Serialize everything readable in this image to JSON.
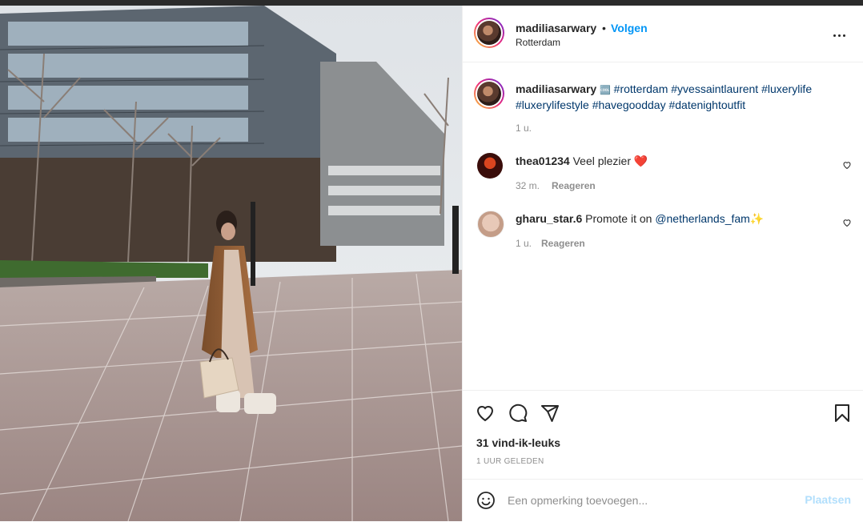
{
  "post": {
    "username": "madiliasarwary",
    "follow_label": "Volgen",
    "location": "Rotterdam",
    "more_icon": "more-options-icon",
    "caption_prefix": "🆒",
    "caption_tags_line1": "#rotterdam #yvessaintlaurent #luxerylife",
    "caption_tags_line2": "#luxerylifestyle #havegoodday #datenightoutfit",
    "caption_time": "1 u."
  },
  "comments": [
    {
      "username": "thea01234",
      "text": "Veel plezier",
      "emoji": "❤️",
      "time": "32 m.",
      "reply": "Reageren"
    },
    {
      "username": "gharu_star.6",
      "text": "Promote it on",
      "mention": "@netherlands_fam",
      "emoji": "✨",
      "time": "1 u.",
      "reply": "Reageren"
    }
  ],
  "actions": {
    "likes": "31 vind-ik-leuks",
    "posted": "1 UUR GELEDEN",
    "icons": [
      "heart-icon",
      "comment-icon",
      "share-icon",
      "bookmark-icon"
    ]
  },
  "comment_box": {
    "placeholder": "Een opmerking toevoegen...",
    "post_label": "Plaatsen"
  },
  "colors": {
    "link": "#0095f6",
    "hashtag": "#00376b",
    "muted": "#8e8e8e",
    "post_disabled": "#b2dffc"
  }
}
